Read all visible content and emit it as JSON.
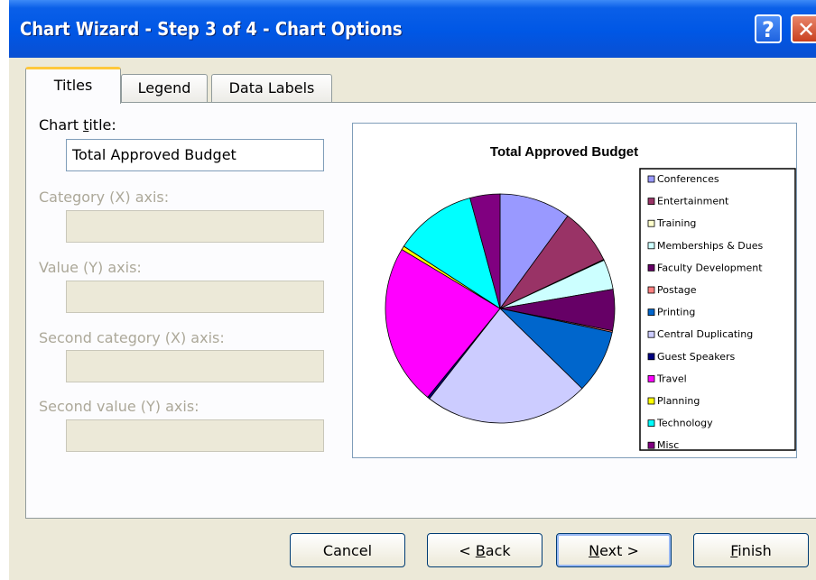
{
  "window": {
    "title": "Chart Wizard - Step 3 of 4 - Chart Options",
    "help_glyph": "?",
    "close_glyph": "✕"
  },
  "tabs": [
    {
      "label": "Titles",
      "active": true
    },
    {
      "label": "Legend",
      "active": false
    },
    {
      "label": "Data Labels",
      "active": false
    }
  ],
  "form": {
    "chart_title": {
      "label_pre": "Chart ",
      "label_ul": "t",
      "label_post": "itle:",
      "value": "Total Approved Budget",
      "enabled": true
    },
    "category_x": {
      "label": "Category (X) axis:",
      "value": "",
      "enabled": false
    },
    "value_y": {
      "label": "Value (Y) axis:",
      "value": "",
      "enabled": false
    },
    "second_category_x": {
      "label": "Second category (X) axis:",
      "value": "",
      "enabled": false
    },
    "second_value_y": {
      "label": "Second value (Y) axis:",
      "value": "",
      "enabled": false
    }
  },
  "chart_data": {
    "type": "pie",
    "title": "Total Approved Budget",
    "legend_position": "right",
    "slices": [
      {
        "label": "Conferences",
        "value": 9.5,
        "color": "#9999ff"
      },
      {
        "label": "Entertainment",
        "value": 7.5,
        "color": "#993366"
      },
      {
        "label": "Training",
        "value": 0.1,
        "color": "#ffffcc"
      },
      {
        "label": "Memberships & Dues",
        "value": 4.0,
        "color": "#ccffff"
      },
      {
        "label": "Faculty Development",
        "value": 5.5,
        "color": "#660066"
      },
      {
        "label": "Postage",
        "value": 0.2,
        "color": "#ff8080"
      },
      {
        "label": "Printing",
        "value": 8.5,
        "color": "#0066cc"
      },
      {
        "label": "Central Duplicating",
        "value": 22.0,
        "color": "#ccccff"
      },
      {
        "label": "Guest Speakers",
        "value": 0.3,
        "color": "#000080"
      },
      {
        "label": "Travel",
        "value": 21.5,
        "color": "#ff00ff"
      },
      {
        "label": "Planning",
        "value": 0.5,
        "color": "#ffff00"
      },
      {
        "label": "Technology",
        "value": 11.0,
        "color": "#00ffff"
      },
      {
        "label": "Misc",
        "value": 4.0,
        "color": "#800080"
      }
    ]
  },
  "buttons": {
    "cancel": {
      "label": "Cancel"
    },
    "back": {
      "pre": "< ",
      "ul": "B",
      "post": "ack"
    },
    "next": {
      "pre": "",
      "ul": "N",
      "post": "ext >"
    },
    "finish": {
      "pre": "",
      "ul": "F",
      "post": "inish"
    }
  }
}
